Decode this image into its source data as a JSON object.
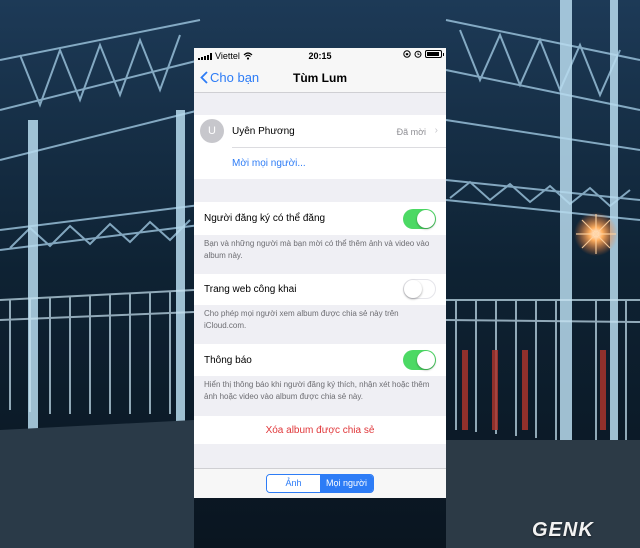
{
  "status_bar": {
    "carrier": "Viettel",
    "time": "20:15",
    "wifi_icon": "wifi-icon",
    "battery_icon": "battery-icon"
  },
  "nav": {
    "back_label": "Cho bạn",
    "title": "Tùm Lum"
  },
  "participants": {
    "avatar_initial": "U",
    "name": "Uyên Phương",
    "status": "Đã mời",
    "invite_label": "Mời mọi người..."
  },
  "settings": {
    "subscribers_post": {
      "label": "Người đăng ký có thể đăng",
      "enabled": true,
      "hint": "Bạn và những người mà bạn mời có thể thêm ảnh và video vào album này."
    },
    "public_website": {
      "label": "Trang web công khai",
      "enabled": false,
      "hint": "Cho phép mọi người xem album được chia sẻ này trên iCloud.com."
    },
    "notifications": {
      "label": "Thông báo",
      "enabled": true,
      "hint": "Hiển thị thông báo khi người đăng ký thích, nhận xét hoặc thêm ảnh hoặc video vào album được chia sẻ này."
    }
  },
  "delete_label": "Xóa album được chia sẻ",
  "bottom_tabs": {
    "photos_label": "Ảnh",
    "people_label": "Mọi người",
    "selected": "Mọi người"
  },
  "watermark": "GENK",
  "colors": {
    "accent": "#2d7cf6",
    "toggle_on": "#4cd964",
    "danger": "#e0373a"
  }
}
